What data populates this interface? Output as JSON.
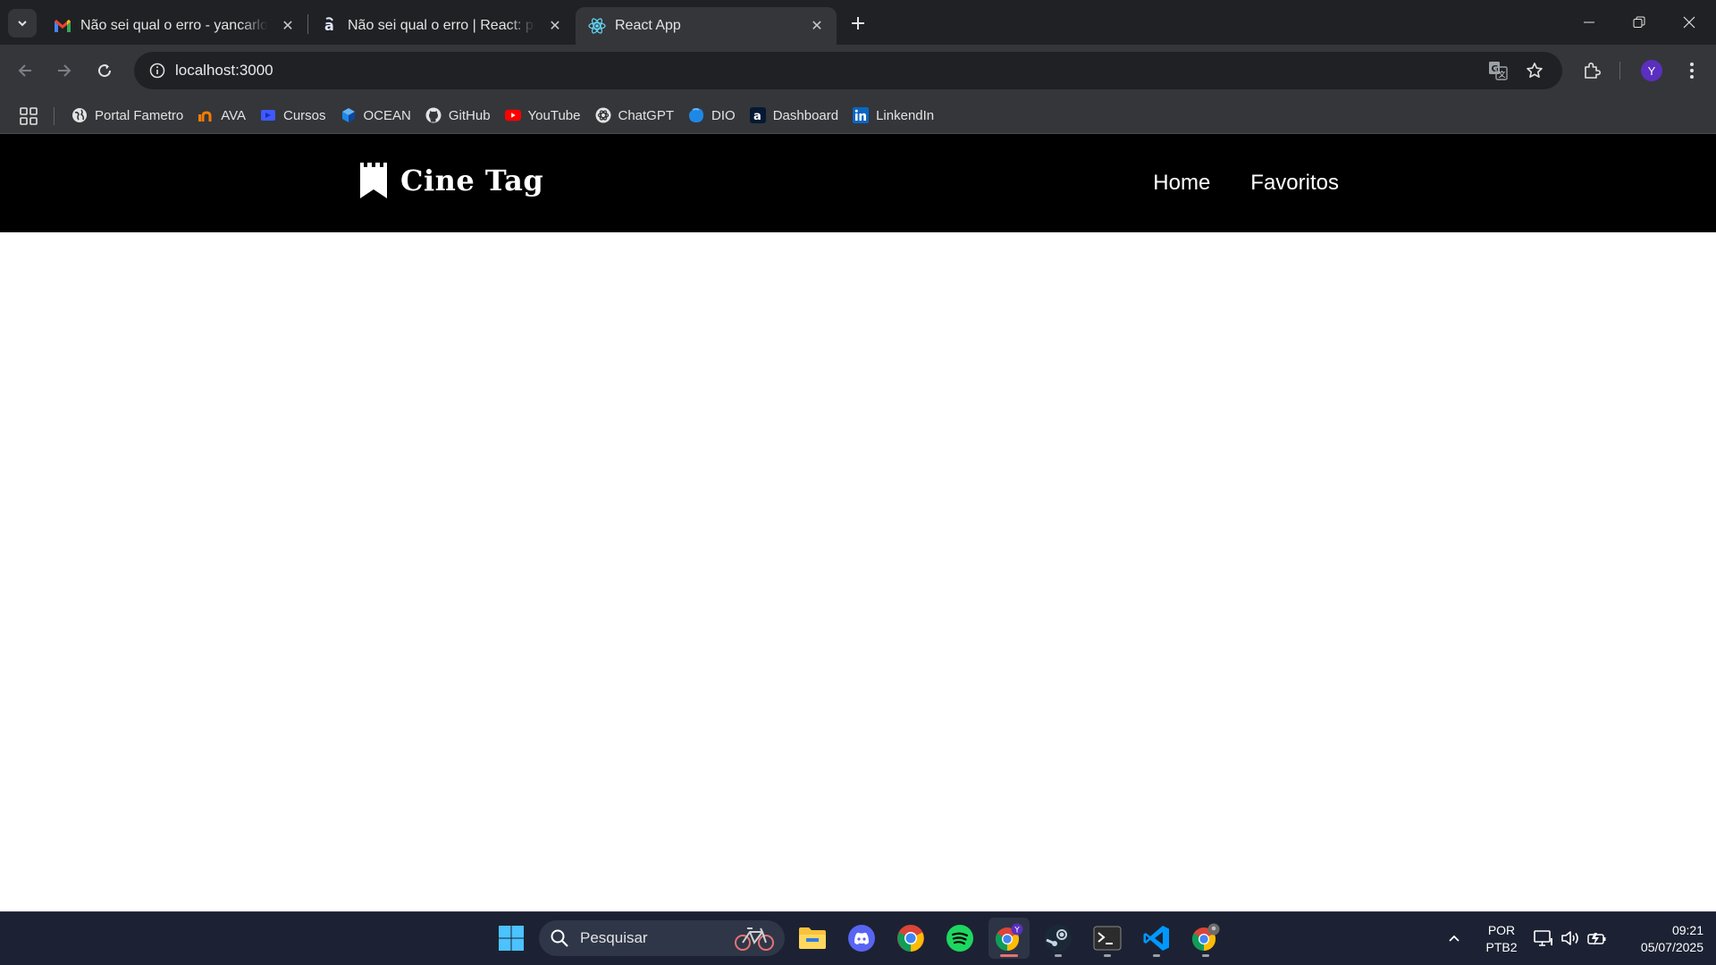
{
  "browser": {
    "tabs": [
      {
        "title": "Não sei qual o erro - yancarloal",
        "favicon": "gmail-icon",
        "active": false
      },
      {
        "title": "Não sei qual o erro | React: prat",
        "favicon": "alura-icon",
        "active": false
      },
      {
        "title": "React App",
        "favicon": "react-icon",
        "active": true
      }
    ],
    "url": "localhost:3000",
    "profile_initial": "Y",
    "bookmarks": [
      {
        "label": "Portal Fametro",
        "icon": "globe-icon"
      },
      {
        "label": "AVA",
        "icon": "ava-icon"
      },
      {
        "label": "Cursos",
        "icon": "cursos-icon"
      },
      {
        "label": "OCEAN",
        "icon": "ocean-icon"
      },
      {
        "label": "GitHub",
        "icon": "github-icon"
      },
      {
        "label": "YouTube",
        "icon": "youtube-icon"
      },
      {
        "label": "ChatGPT",
        "icon": "chatgpt-icon"
      },
      {
        "label": "DIO",
        "icon": "dio-icon"
      },
      {
        "label": "Dashboard",
        "icon": "alura-icon"
      },
      {
        "label": "LinkendIn",
        "icon": "linkedin-icon"
      }
    ]
  },
  "site": {
    "logo_text": "Cine Tag",
    "nav": [
      {
        "label": "Home"
      },
      {
        "label": "Favoritos"
      }
    ]
  },
  "taskbar": {
    "search_placeholder": "Pesquisar",
    "apps": [
      "file-explorer-icon",
      "discord-icon",
      "chrome-icon",
      "spotify-icon",
      "chrome-profile-icon",
      "steam-icon",
      "terminal-icon",
      "vscode-icon",
      "chrome-canary-icon"
    ],
    "lang_line1": "POR",
    "lang_line2": "PTB2",
    "time": "09:21",
    "date": "05/07/2025"
  },
  "colors": {
    "chrome_dark": "#202124",
    "chrome_toolbar": "#35363a",
    "site_header": "#000000",
    "taskbar": "#1c2233"
  }
}
